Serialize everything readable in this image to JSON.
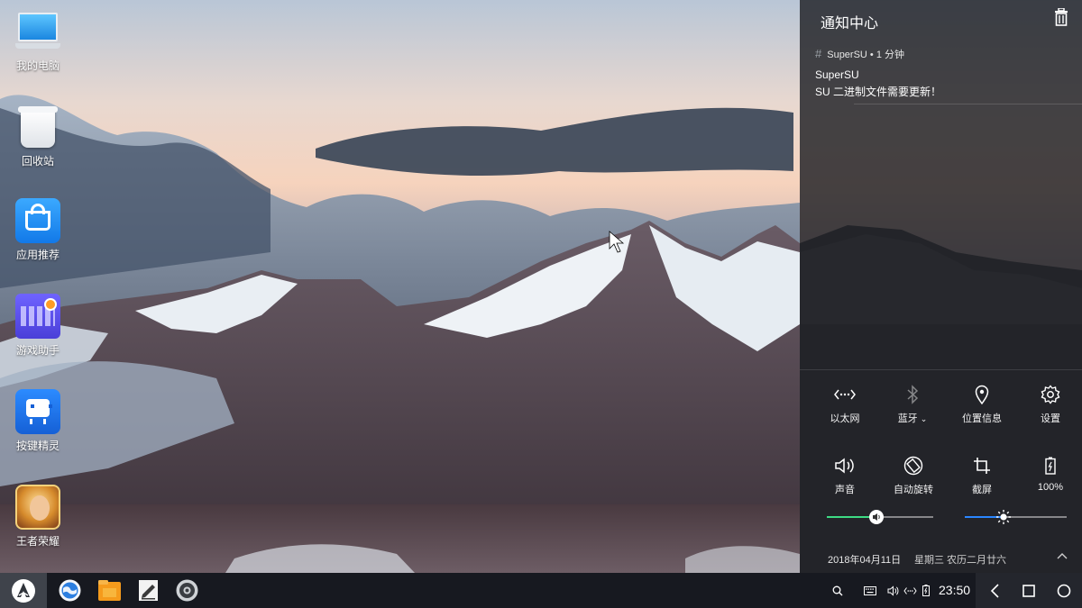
{
  "desktop": {
    "icons": [
      {
        "label": "我的电脑",
        "icon": "computer-icon"
      },
      {
        "label": "回收站",
        "icon": "recycle-bin-icon"
      },
      {
        "label": "应用推荐",
        "icon": "app-store-icon"
      },
      {
        "label": "游戏助手",
        "icon": "game-assistant-icon"
      },
      {
        "label": "按键精灵",
        "icon": "key-sprite-icon"
      },
      {
        "label": "王者荣耀",
        "icon": "honor-of-kings-icon"
      }
    ]
  },
  "notification_center": {
    "title": "通知中心",
    "notification": {
      "header": "SuperSU • 1 分钟",
      "app": "SuperSU",
      "message": "SU 二进制文件需要更新！"
    },
    "quick_settings": [
      {
        "label": "以太网",
        "icon": "ethernet-icon",
        "enabled": true
      },
      {
        "label": "蓝牙",
        "icon": "bluetooth-icon",
        "enabled": false,
        "has_dropdown": true
      },
      {
        "label": "位置信息",
        "icon": "location-icon",
        "enabled": true
      },
      {
        "label": "设置",
        "icon": "settings-gear-icon",
        "enabled": true
      },
      {
        "label": "声音",
        "icon": "volume-icon",
        "enabled": true
      },
      {
        "label": "自动旋转",
        "icon": "auto-rotate-icon",
        "enabled": true
      },
      {
        "label": "截屏",
        "icon": "screenshot-crop-icon",
        "enabled": true
      },
      {
        "label": "100%",
        "icon": "battery-icon",
        "enabled": true
      }
    ],
    "volume_level": 0.47,
    "brightness_level": 0.38,
    "date": "2018年04月11日",
    "date_extra": "星期三 农历二月廿六"
  },
  "taskbar": {
    "apps": [
      "browser-icon",
      "file-manager-icon",
      "notes-icon",
      "settings-app-icon"
    ],
    "tray_icons": [
      "search-icon",
      "keyboard-icon",
      "volume-icon",
      "ethernet-icon",
      "battery-icon"
    ],
    "clock": "23:50"
  },
  "colors": {
    "accent_green": "#3ddc84",
    "accent_blue": "#2a86ff",
    "panel_bg": "#1e2024"
  }
}
